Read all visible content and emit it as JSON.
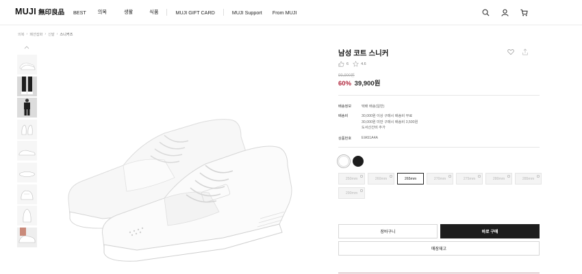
{
  "header": {
    "logo_en": "MUJI",
    "logo_kr": "無印良品",
    "nav": [
      "BEST",
      "의복",
      "생활",
      "식품",
      "MUJI GIFT CARD",
      "MUJI Support",
      "From MUJI"
    ],
    "icons": [
      "search-icon",
      "user-icon",
      "cart-icon"
    ]
  },
  "breadcrumb": [
    "의복",
    "패션잡화",
    "신발",
    "스니커즈"
  ],
  "thumbnails": [
    "shoe-pair-side",
    "model-legs-black-pants",
    "model-full-black-outfit",
    "shoe-front-pair",
    "shoe-side-single",
    "shoe-sole",
    "shoe-back-detail",
    "shoe-top-view",
    "shoe-on-foot"
  ],
  "product": {
    "title": "남성 코트 스니커",
    "likes": "6",
    "rating": "4.6",
    "original_price": "99,900원",
    "discount": "60%",
    "price": "39,900원"
  },
  "info": {
    "delivery_label": "배송정보",
    "delivery_value": "택배 배송(일반)",
    "shipping_label": "배송비",
    "shipping_lines": [
      "30,000원 이상 구매시 배송비 무료",
      "30,000원 미만 구매시 배송비 3,500원",
      "도서산간비 추가"
    ],
    "code_label": "상품번호",
    "code_value": "EIA51A4A"
  },
  "colors": [
    {
      "name": "white",
      "hex": "#ffffff",
      "selected": true
    },
    {
      "name": "black",
      "hex": "#1d1d1d",
      "selected": false
    }
  ],
  "sizes": [
    {
      "label": "250mm",
      "available": false
    },
    {
      "label": "260mm",
      "available": false
    },
    {
      "label": "265mm",
      "available": true
    },
    {
      "label": "270mm",
      "available": false
    },
    {
      "label": "275mm",
      "available": false
    },
    {
      "label": "280mm",
      "available": false
    },
    {
      "label": "285mm",
      "available": false
    },
    {
      "label": "290mm",
      "available": false
    }
  ],
  "buttons": {
    "cart": "장바구니",
    "buy": "바로 구매",
    "stock": "매장재고"
  },
  "accent": "#b0243a"
}
